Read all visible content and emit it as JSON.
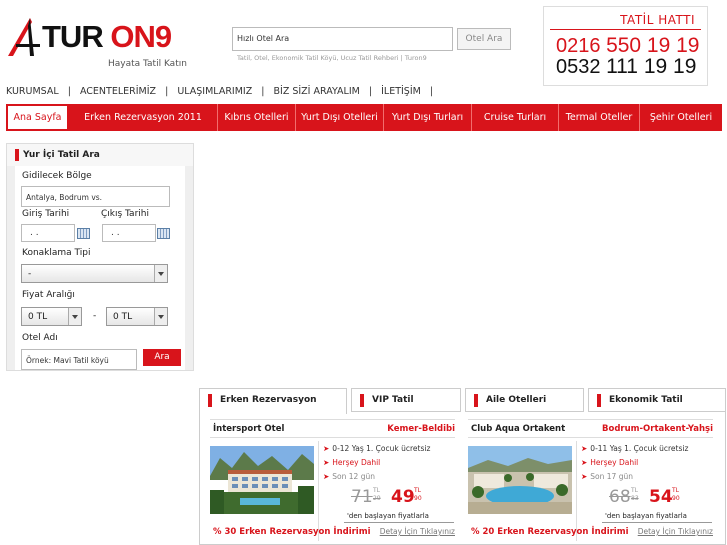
{
  "brand": {
    "logo_text_a": "TUR",
    "logo_text_b": "ON9",
    "slogan": "Hayata Tatil Katın"
  },
  "search": {
    "value": "Hızlı Otel Ara",
    "button": "Otel Ara",
    "tags": "Tatil, Otel, Ekonomik Tatil Köyü, Ucuz Tatil Rehberi | Turon9"
  },
  "hotline": {
    "title": "TATİL HATTI",
    "line1_prefix": "0216",
    "line1_number": "550 19 19",
    "line2_prefix": "0532",
    "line2_number": "111 19 19"
  },
  "top_nav": [
    "KURUMSAL",
    "|",
    "ACENTELERİMİZ",
    "|",
    "ULAŞIMLARIMIZ",
    "|",
    "BİZ SİZİ ARAYALIM",
    "|",
    "İLETİŞİM",
    "|"
  ],
  "main_nav": [
    "Ana Sayfa",
    "Erken Rezervasyon 2011",
    "Kıbrıs Otelleri",
    "Yurt Dışı Otelleri",
    "Yurt Dışı Turları",
    "Cruise Turları",
    "Termal Oteller",
    "Şehir Otelleri"
  ],
  "search_panel": {
    "title": "Yur İçi Tatil Ara",
    "region_label": "Gidilecek Bölge",
    "region_placeholder": "Antalya, Bodrum vs.",
    "checkin_label": "Giriş Tarihi",
    "checkout_label": "Çıkış Tarihi",
    "checkin_value": ". .",
    "checkout_value": ". .",
    "accommodation_label": "Konaklama Tipi",
    "accommodation_value": "-",
    "price_label": "Fiyat Aralığı",
    "price_min": "0 TL",
    "price_dash": "-",
    "price_max": "0 TL",
    "hotel_label": "Otel Adı",
    "hotel_placeholder": "Örnek: Mavi Tatil köyü",
    "button": "Ara"
  },
  "tabs": [
    "Erken Rezervasyon",
    "VIP Tatil",
    "Aile Otelleri",
    "Ekonomik Tatil"
  ],
  "cards": [
    {
      "name": "İntersport Otel",
      "location": "Kemer-Beldibi",
      "features": [
        "0-12 Yaş 1. Çocuk ücretsiz",
        "Herşey Dahil",
        "Son 12 gün"
      ],
      "old_price": "71",
      "old_cents": "29",
      "new_price": "49",
      "new_cents": "90",
      "currency": "TL",
      "from_text": "'den başlayan fiyatlarla",
      "discount": "% 30 Erken Rezervasyon İndirimi",
      "detail": "Detay İçin Tıklayınız"
    },
    {
      "name": "Club Aqua Ortakent",
      "location": "Bodrum-Ortakent-Yahşi",
      "features": [
        "0-11 Yaş 1. Çocuk ücretsiz",
        "Herşey Dahil",
        "Son 17 gün"
      ],
      "old_price": "68",
      "old_cents": "83",
      "new_price": "54",
      "new_cents": "90",
      "currency": "TL",
      "from_text": "'den başlayan fiyatlarla",
      "discount": "% 20 Erken Rezervasyon İndirimi",
      "detail": "Detay İçin Tıklayınız"
    }
  ],
  "colors": {
    "brand_red": "#d8141b"
  }
}
